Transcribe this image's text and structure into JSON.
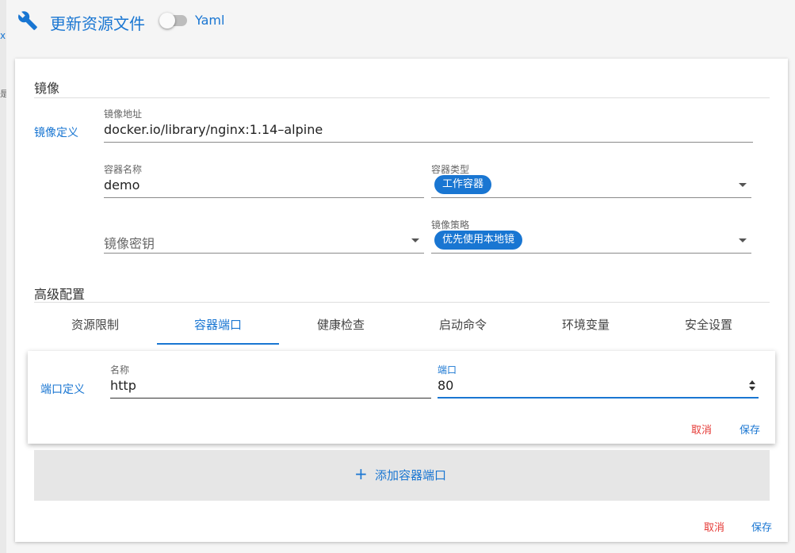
{
  "backdrop": {
    "fragment_x": "x",
    "fragment_t": "是"
  },
  "header": {
    "icon": "wrench-icon",
    "title": "更新资源文件",
    "yaml_toggle": {
      "label": "Yaml",
      "checked": false
    }
  },
  "image_section": {
    "title": "镜像",
    "side_label": "镜像定义",
    "image_address": {
      "label": "镜像地址",
      "value": "docker.io/library/nginx:1.14–alpine"
    },
    "container_name": {
      "label": "容器名称",
      "value": "demo"
    },
    "container_type": {
      "label": "容器类型",
      "selected": "工作容器"
    },
    "image_secret": {
      "placeholder": "镜像密钥"
    },
    "image_policy": {
      "label": "镜像策略",
      "selected": "优先使用本地镜"
    }
  },
  "advanced": {
    "title": "高级配置",
    "tabs": [
      {
        "label": "资源限制"
      },
      {
        "label": "容器端口"
      },
      {
        "label": "健康检查"
      },
      {
        "label": "启动命令"
      },
      {
        "label": "环境变量"
      },
      {
        "label": "安全设置"
      }
    ],
    "active_tab": "容器端口"
  },
  "port_form": {
    "side_label": "端口定义",
    "name": {
      "label": "名称",
      "value": "http"
    },
    "port": {
      "label": "端口",
      "value": "80"
    },
    "cancel_label": "取消",
    "save_label": "保存"
  },
  "add_port": {
    "label": "添加容器端口"
  },
  "footer": {
    "cancel_label": "取消",
    "save_label": "保存"
  },
  "colors": {
    "accent": "#1976d2",
    "danger": "#e53935"
  }
}
